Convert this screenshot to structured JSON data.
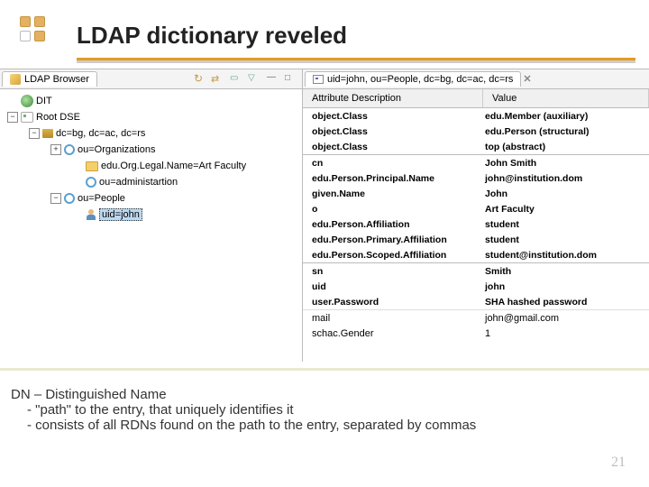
{
  "slide": {
    "title": "LDAP dictionary reveled",
    "page_number": "21"
  },
  "left_panel": {
    "tab_label": "LDAP Browser"
  },
  "tree": {
    "root": "DIT",
    "dse": "Root DSE",
    "dc": "dc=bg, dc=ac, dc=rs",
    "ou_org": "ou=Organizations",
    "art": "edu.Org.Legal.Name=Art Faculty",
    "admin": "ou=administartion",
    "people": "ou=People",
    "uid": "uid=john"
  },
  "right_panel": {
    "tab_label": "uid=john, ou=People, dc=bg, dc=ac, dc=rs",
    "header_attr": "Attribute Description",
    "header_val": "Value"
  },
  "rows": [
    {
      "a": "object.Class",
      "v": "edu.Member (auxiliary)",
      "b": true
    },
    {
      "a": "object.Class",
      "v": "edu.Person (structural)",
      "b": true
    },
    {
      "a": "object.Class",
      "v": "top (abstract)",
      "b": true
    },
    {
      "a": "cn",
      "v": "John Smith",
      "b": true
    },
    {
      "a": "edu.Person.Principal.Name",
      "v": "john@institution.dom",
      "b": true
    },
    {
      "a": "given.Name",
      "v": "John",
      "b": true
    },
    {
      "a": "o",
      "v": "Art Faculty",
      "b": true
    },
    {
      "a": "edu.Person.Affiliation",
      "v": "student",
      "b": true
    },
    {
      "a": "edu.Person.Primary.Affiliation",
      "v": "student",
      "b": true
    },
    {
      "a": "edu.Person.Scoped.Affiliation",
      "v": "student@institution.dom",
      "b": true
    },
    {
      "a": "sn",
      "v": "Smith",
      "b": true
    },
    {
      "a": "uid",
      "v": "john",
      "b": true
    },
    {
      "a": "user.Password",
      "v": "SHA hashed password",
      "b": true
    },
    {
      "a": "mail",
      "v": "john@gmail.com",
      "b": false
    },
    {
      "a": "schac.Gender",
      "v": "1",
      "b": false
    }
  ],
  "footer": {
    "line1": "DN – Distinguished Name",
    "line2": "- \"path\" to the entry, that uniquely identifies it",
    "line3": "- consists of all RDNs found on the path to the entry, separated by commas"
  }
}
